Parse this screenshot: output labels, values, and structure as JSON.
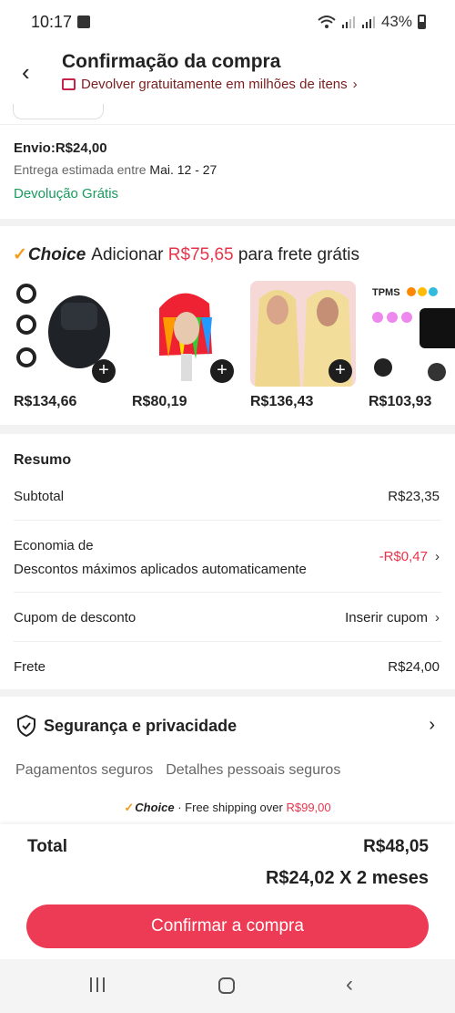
{
  "status_bar": {
    "time": "10:17",
    "battery": "43%"
  },
  "header": {
    "title": "Confirmação da compra",
    "returns_text": "Devolver gratuitamente em milhões de itens",
    "returns_chevron": "›"
  },
  "shipping": {
    "envio": "Envio:R$24,00",
    "entrega_prefix": "Entrega estimada entre",
    "entrega_dates": "Mai. 12 - 27",
    "devolucao": "Devolução Grátis"
  },
  "choice": {
    "logo": "Choice",
    "add_prefix": "Adicionar",
    "amount": "R$75,65",
    "add_suffix": "para frete grátis",
    "products": [
      {
        "price": "R$134,66",
        "image": "ring-product"
      },
      {
        "price": "R$80,19",
        "image": "rainbow-wig"
      },
      {
        "price": "R$136,43",
        "image": "blonde-wig"
      },
      {
        "price": "R$103,93",
        "image": "tpms-device"
      }
    ]
  },
  "summary": {
    "title": "Resumo",
    "subtotal_label": "Subtotal",
    "subtotal_value": "R$23,35",
    "economia_label": "Economia de",
    "economia_sub": "Descontos máximos aplicados automaticamente",
    "economia_value": "-R$0,47",
    "cupom_label": "Cupom de desconto",
    "cupom_value": "Inserir cupom",
    "frete_label": "Frete",
    "frete_value": "R$24,00"
  },
  "security": {
    "title": "Segurança e privacidade",
    "item1": "Pagamentos seguros",
    "item2": "Detalhes pessoais seguros",
    "free_logo": "Choice",
    "free_text": "· Free shipping over",
    "free_amount": "R$99,00",
    "tpms_label": "TPMS"
  },
  "bottom": {
    "total_label": "Total",
    "total_value": "R$48,05",
    "installment": "R$24,02 X 2 meses",
    "confirm": "Confirmar a compra"
  },
  "colors": {
    "accent": "#ee3b55",
    "green": "#1a9a5c",
    "choice_check": "#f49c1b"
  }
}
